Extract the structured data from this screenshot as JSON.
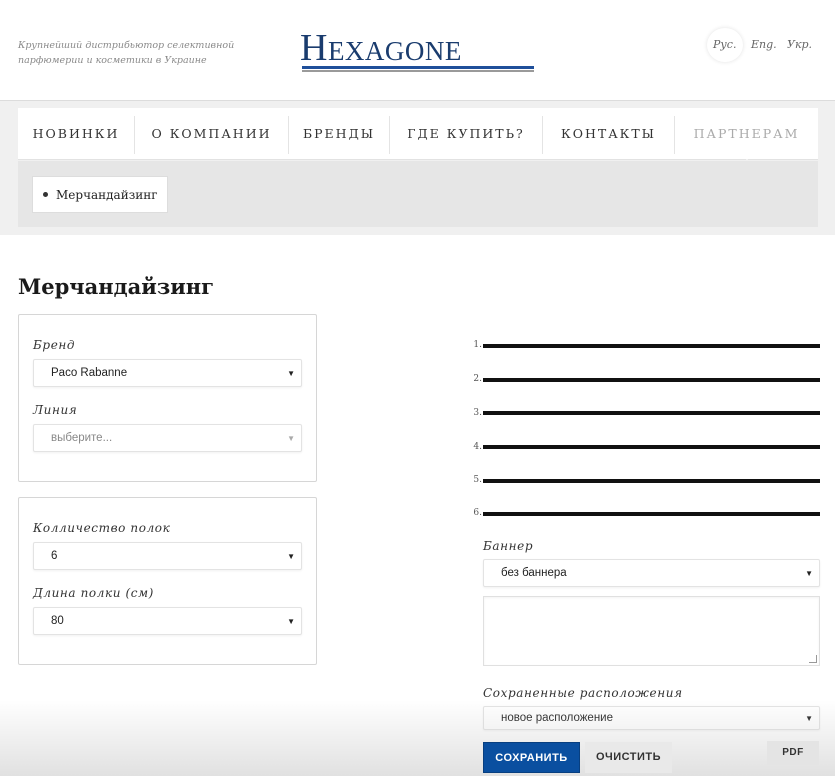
{
  "header": {
    "tagline": "Крупнейший дистрибьютор селективной парфюмерии и косметики в Украине",
    "logo_text": "Hexagone",
    "languages": [
      "Рус.",
      "Eng.",
      "Укр."
    ]
  },
  "nav": {
    "items": [
      "НОВИНКИ",
      "О КОМПАНИИ",
      "БРЕНДЫ",
      "ГДЕ КУПИТЬ?",
      "КОНТАКТЫ",
      "ПАРТНЕРАМ"
    ]
  },
  "subnav": {
    "items": [
      "Мерчандайзинг"
    ]
  },
  "page": {
    "title": "Мерчандайзинг"
  },
  "form": {
    "brand_label": "Бренд",
    "brand_value": "Paco Rabanne",
    "line_label": "Линия",
    "line_placeholder": "выберите...",
    "shelves_label": "Колличество полок",
    "shelves_value": "6",
    "shelf_length_label": "Длина полки (см)",
    "shelf_length_value": "80"
  },
  "shelves": [
    "1.",
    "2.",
    "3.",
    "4.",
    "5.",
    "6."
  ],
  "banner": {
    "label": "Баннер",
    "value": "без баннера",
    "textarea_value": ""
  },
  "saved": {
    "label": "Сохраненные расположения",
    "value": "новое расположение"
  },
  "buttons": {
    "save": "СОХРАНИТЬ",
    "clear": "ОЧИСТИТЬ",
    "pdf": "PDF"
  },
  "colors": {
    "brand_blue": "#1a3c6e",
    "save_button": "#0a4fa0",
    "nav_inactive": "#aaaaaa"
  }
}
